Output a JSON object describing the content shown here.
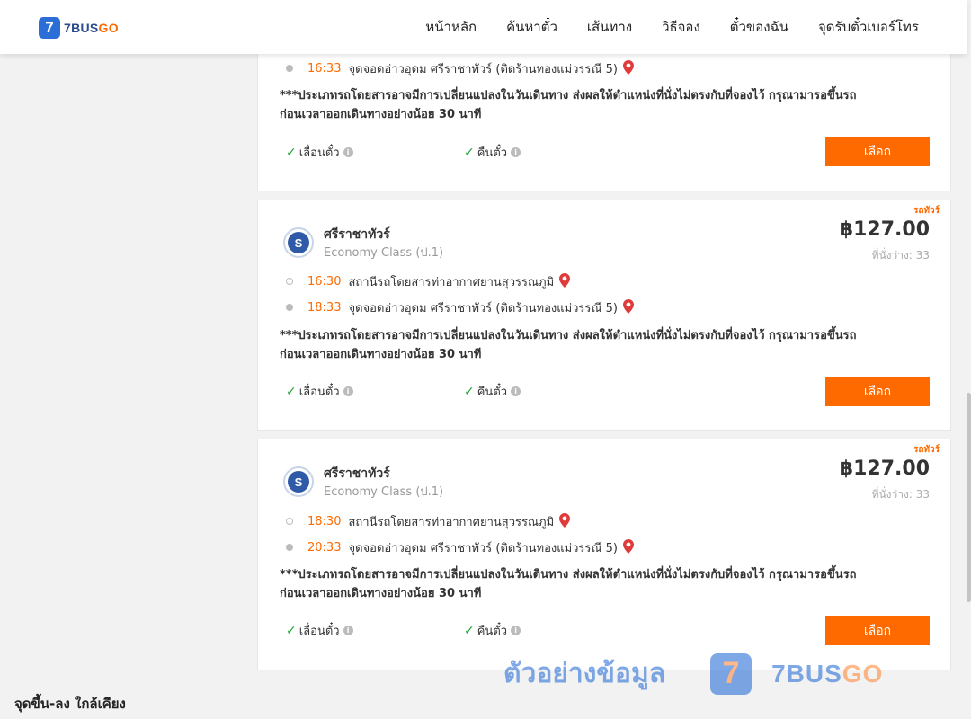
{
  "brand": {
    "logo_mark": "7",
    "name_part1": "7BUS",
    "name_part2": "GO"
  },
  "nav": [
    "หน้าหลัก",
    "ค้นหาตั๋ว",
    "เส้นทาง",
    "วิธีจอง",
    "ตั๋วของฉัน",
    "จุดรับตั๋วเบอร์โทร"
  ],
  "first_card": {
    "arrival_time": "16:33",
    "arrival_place": "จุดจอดอ่าวอุดม ศรีราชาทัวร์ (ติดร้านทองแม่วรรณี 5)",
    "notice_line1": "***ประเภทรถโดยสารอาจมีการเปลี่ยนแปลงในวันเดินทาง ส่งผลให้ตำแหน่งที่นั่งไม่ตรงกับที่จองไว้ กรุณามารอขึ้นรถ",
    "notice_line2": "ก่อนเวลาออกเดินทางอย่างน้อย 30 นาที",
    "change_ticket": "เลื่อนตั๋ว",
    "refund_ticket": "คืนตั๋ว",
    "select": "เลือก"
  },
  "trips": [
    {
      "type_label": "รถทัวร์",
      "operator": "ศรีราชาทัวร์",
      "class": "Economy Class (ป.1)",
      "price": "฿127.00",
      "seats": "ที่นั่งว่าง: 33",
      "depart_time": "16:30",
      "depart_place": "สถานีรถโดยสารท่าอากาศยานสุวรรณภูมิ",
      "arrive_time": "18:33",
      "arrive_place": "จุดจอดอ่าวอุดม ศรีราชาทัวร์ (ติดร้านทองแม่วรรณี 5)",
      "notice_line1": "***ประเภทรถโดยสารอาจมีการเปลี่ยนแปลงในวันเดินทาง ส่งผลให้ตำแหน่งที่นั่งไม่ตรงกับที่จองไว้ กรุณามารอขึ้นรถ",
      "notice_line2": "ก่อนเวลาออกเดินทางอย่างน้อย 30 นาที",
      "change_ticket": "เลื่อนตั๋ว",
      "refund_ticket": "คืนตั๋ว",
      "select": "เลือก"
    },
    {
      "type_label": "รถทัวร์",
      "operator": "ศรีราชาทัวร์",
      "class": "Economy Class (ป.1)",
      "price": "฿127.00",
      "seats": "ที่นั่งว่าง: 33",
      "depart_time": "18:30",
      "depart_place": "สถานีรถโดยสารท่าอากาศยานสุวรรณภูมิ",
      "arrive_time": "20:33",
      "arrive_place": "จุดจอดอ่าวอุดม ศรีราชาทัวร์ (ติดร้านทองแม่วรรณี 5)",
      "notice_line1": "***ประเภทรถโดยสารอาจมีการเปลี่ยนแปลงในวันเดินทาง ส่งผลให้ตำแหน่งที่นั่งไม่ตรงกับที่จองไว้ กรุณามารอขึ้นรถ",
      "notice_line2": "ก่อนเวลาออกเดินทางอย่างน้อย 30 นาที",
      "change_ticket": "เลื่อนตั๋ว",
      "refund_ticket": "คืนตั๋ว",
      "select": "เลือก"
    }
  ],
  "sidebar_heading": "จุดขึ้น-ลง ใกล้เคียง",
  "watermark": {
    "text": "ตัวอย่างข้อมูล",
    "logo_mark": "7",
    "brand_part1": "7BUS",
    "brand_part2": "GO"
  },
  "icons": {
    "check": "check-icon",
    "info": "info-icon",
    "pin": "map-pin-icon"
  },
  "colors": {
    "accent": "#ff6a00",
    "brand_blue": "#2b6fd6",
    "check_green": "#22a335",
    "pin_red": "#e03b3b"
  }
}
